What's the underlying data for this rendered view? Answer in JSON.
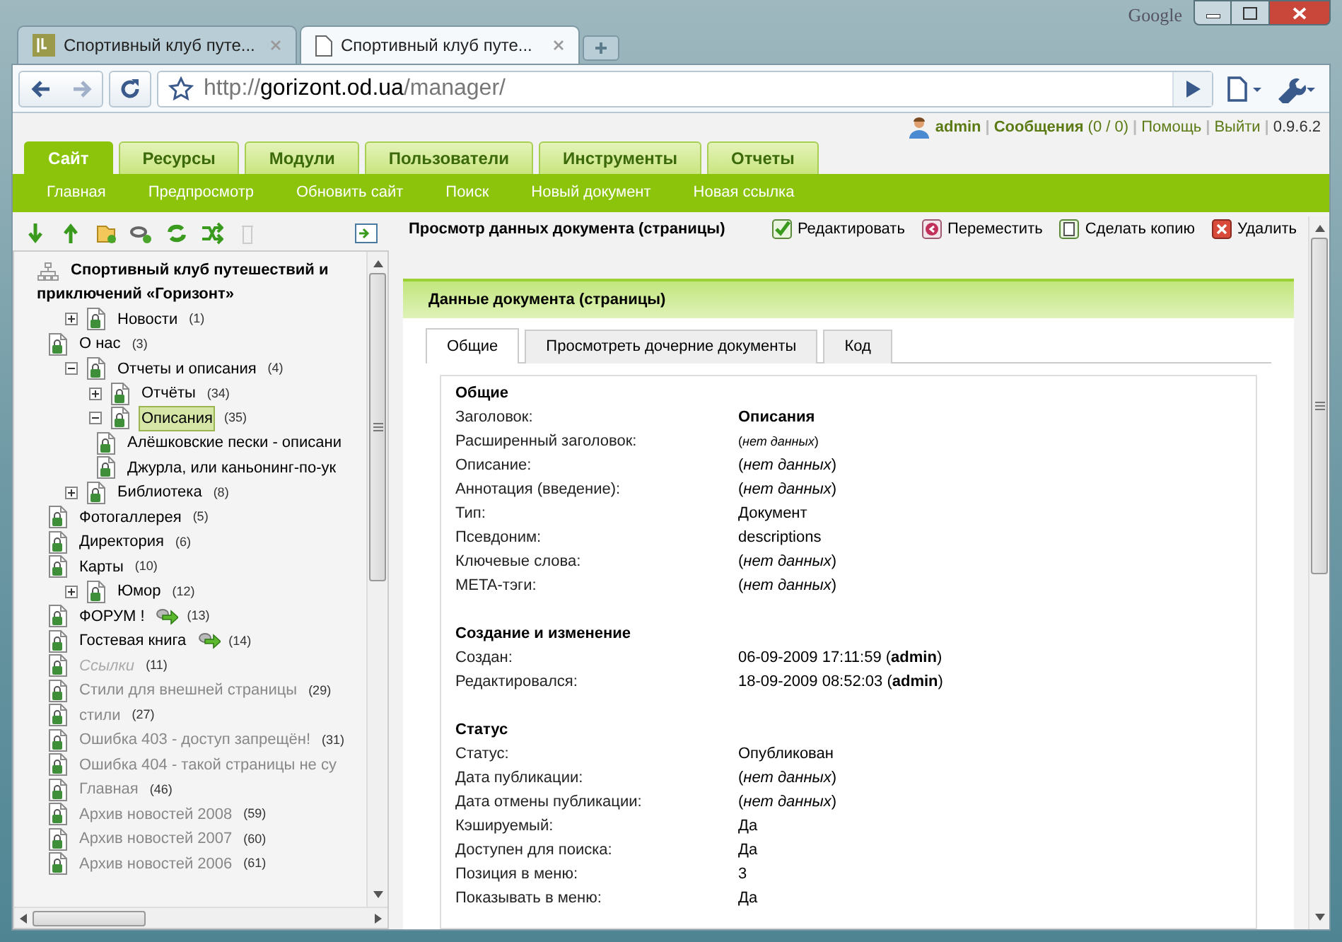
{
  "browser": {
    "brand": "Google",
    "tabs": [
      {
        "title": "Спортивный клуб путе...",
        "selected": false
      },
      {
        "title": "Спортивный клуб путе...",
        "selected": true
      }
    ],
    "url": {
      "scheme": "http://",
      "host": "gorizont.od.ua",
      "path": "/manager/"
    }
  },
  "user_bar": {
    "user": "admin",
    "links": [
      "**Сообщения** (0 / 0)",
      "Помощь",
      "Выйти"
    ],
    "version": "0.9.6.2",
    "separator": "|"
  },
  "main_tabs": [
    {
      "label": "Сайт",
      "selected": true
    },
    {
      "label": "Ресурсы",
      "selected": false
    },
    {
      "label": "Модули",
      "selected": false
    },
    {
      "label": "Пользователи",
      "selected": false
    },
    {
      "label": "Инструменты",
      "selected": false
    },
    {
      "label": "Отчеты",
      "selected": false
    }
  ],
  "submenu": [
    "Главная",
    "Предпросмотр",
    "Обновить сайт",
    "Поиск",
    "Новый документ",
    "Новая ссылка"
  ],
  "tree": {
    "root": "Спортивный клуб путешествий и приключений «Горизонт»",
    "items": [
      {
        "label": "Новости",
        "count": "(1)",
        "kind": "page",
        "expanded": false,
        "selected": false,
        "in_menu": true,
        "published": true
      },
      {
        "label": "О нас",
        "count": "(3)",
        "kind": "page",
        "selected": false,
        "in_menu": true,
        "published": true
      },
      {
        "label": "Отчеты и описания",
        "count": "(4)",
        "kind": "page",
        "expanded": true,
        "selected": false,
        "in_menu": true,
        "published": true,
        "children": [
          {
            "label": "Отчёты",
            "count": "(34)",
            "kind": "page",
            "expanded": false,
            "selected": false,
            "in_menu": true,
            "published": true
          },
          {
            "label": "Описания",
            "count": "(35)",
            "kind": "page",
            "expanded": true,
            "selected": true,
            "in_menu": true,
            "published": true,
            "children": [
              {
                "label": "Алёшковские пески - описани",
                "kind": "page",
                "selected": false,
                "in_menu": true,
                "published": true
              },
              {
                "label": "Джурла, или каньонинг-по-ук",
                "kind": "page",
                "selected": false,
                "in_menu": true,
                "published": true
              }
            ]
          }
        ]
      },
      {
        "label": "Библиотека",
        "count": "(8)",
        "kind": "page",
        "expanded": false,
        "selected": false,
        "in_menu": true,
        "published": true
      },
      {
        "label": "Фотогаллерея",
        "count": "(5)",
        "kind": "page",
        "selected": false,
        "in_menu": true,
        "published": true
      },
      {
        "label": "Директория",
        "count": "(6)",
        "kind": "page",
        "selected": false,
        "in_menu": true,
        "published": true
      },
      {
        "label": "Карты",
        "count": "(10)",
        "kind": "page",
        "selected": false,
        "in_menu": true,
        "published": true
      },
      {
        "label": "Юмор",
        "count": "(12)",
        "kind": "page",
        "expanded": false,
        "selected": false,
        "in_menu": true,
        "published": true
      },
      {
        "label": "ФОРУМ !",
        "count": "(13)",
        "kind": "weblink",
        "selected": false,
        "in_menu": true,
        "published": true
      },
      {
        "label": "Гостевая книга",
        "count": "(14)",
        "kind": "weblink",
        "selected": false,
        "in_menu": true,
        "published": true
      },
      {
        "label": "Ссылки",
        "count": "(11)",
        "kind": "page",
        "selected": false,
        "in_menu": false,
        "published": false
      },
      {
        "label": "Стили для внешней страницы",
        "count": "(29)",
        "kind": "page",
        "selected": false,
        "in_menu": false,
        "published": true
      },
      {
        "label": "стили",
        "count": "(27)",
        "kind": "page",
        "selected": false,
        "in_menu": false,
        "published": true
      },
      {
        "label": "Ошибка 403 - доступ запрещён!",
        "count": "(31)",
        "kind": "page",
        "selected": false,
        "in_menu": false,
        "published": true
      },
      {
        "label": "Ошибка 404 - такой страницы не су",
        "kind": "page",
        "selected": false,
        "in_menu": false,
        "published": true
      },
      {
        "label": "Главная",
        "count": "(46)",
        "kind": "page",
        "selected": false,
        "in_menu": false,
        "published": true
      },
      {
        "label": "Архив новостей 2008",
        "count": "(59)",
        "kind": "page",
        "selected": false,
        "in_menu": false,
        "published": true
      },
      {
        "label": "Архив новостей 2007",
        "count": "(60)",
        "kind": "page",
        "selected": false,
        "in_menu": false,
        "published": true
      },
      {
        "label": "Архив новостей 2006",
        "count": "(61)",
        "kind": "page",
        "selected": false,
        "in_menu": false,
        "published": true
      }
    ]
  },
  "content": {
    "title": "Просмотр данных документа (страницы)",
    "actions": [
      {
        "label": "Редактировать",
        "kind": "edit"
      },
      {
        "label": "Переместить",
        "kind": "move"
      },
      {
        "label": "Сделать копию",
        "kind": "copy"
      },
      {
        "label": "Удалить",
        "kind": "delete"
      }
    ],
    "panel_title": "Данные документа (страницы)",
    "tabs": [
      {
        "label": "Общие",
        "selected": true
      },
      {
        "label": "Просмотреть дочерние документы",
        "selected": false
      },
      {
        "label": "Код",
        "selected": false
      }
    ],
    "sections": [
      {
        "title": "Общие",
        "rows": [
          {
            "label": "Заголовок:",
            "value": "Описания",
            "kind": "strong"
          },
          {
            "label": "Расширенный заголовок:",
            "value": "(*нет данных*)",
            "kind": "small"
          },
          {
            "label": "Описание:",
            "value": "(*нет данных*)",
            "kind": "plain"
          },
          {
            "label": "Аннотация (введение):",
            "value": "(*нет данных*)",
            "kind": "plain"
          },
          {
            "label": "Тип:",
            "value": "Документ",
            "kind": "plain"
          },
          {
            "label": "Псевдоним:",
            "value": "descriptions",
            "kind": "plain"
          },
          {
            "label": "Ключевые слова:",
            "value": "(*нет данных*)",
            "kind": "plain"
          },
          {
            "label": "META-тэги:",
            "value": "(*нет данных*)",
            "kind": "plain"
          }
        ]
      },
      {
        "title": "Создание и изменение",
        "rows": [
          {
            "label": "Создан:",
            "value": "06-09-2009 17:11:59 (**admin**)",
            "kind": "plain"
          },
          {
            "label": "Редактировался:",
            "value": "18-09-2009 08:52:03 (**admin**)",
            "kind": "plain"
          }
        ]
      },
      {
        "title": "Статус",
        "rows": [
          {
            "label": "Статус:",
            "value": "Опубликован",
            "kind": "plain"
          },
          {
            "label": "Дата публикации:",
            "value": "(*нет данных*)",
            "kind": "plain"
          },
          {
            "label": "Дата отмены публикации:",
            "value": "(*нет данных*)",
            "kind": "plain"
          },
          {
            "label": "Кэшируемый:",
            "value": "Да",
            "kind": "plain"
          },
          {
            "label": "Доступен для поиска:",
            "value": "Да",
            "kind": "plain"
          },
          {
            "label": "Позиция в меню:",
            "value": "3",
            "kind": "plain"
          },
          {
            "label": "Показывать в меню:",
            "value": "Да",
            "kind": "plain"
          }
        ]
      }
    ]
  }
}
